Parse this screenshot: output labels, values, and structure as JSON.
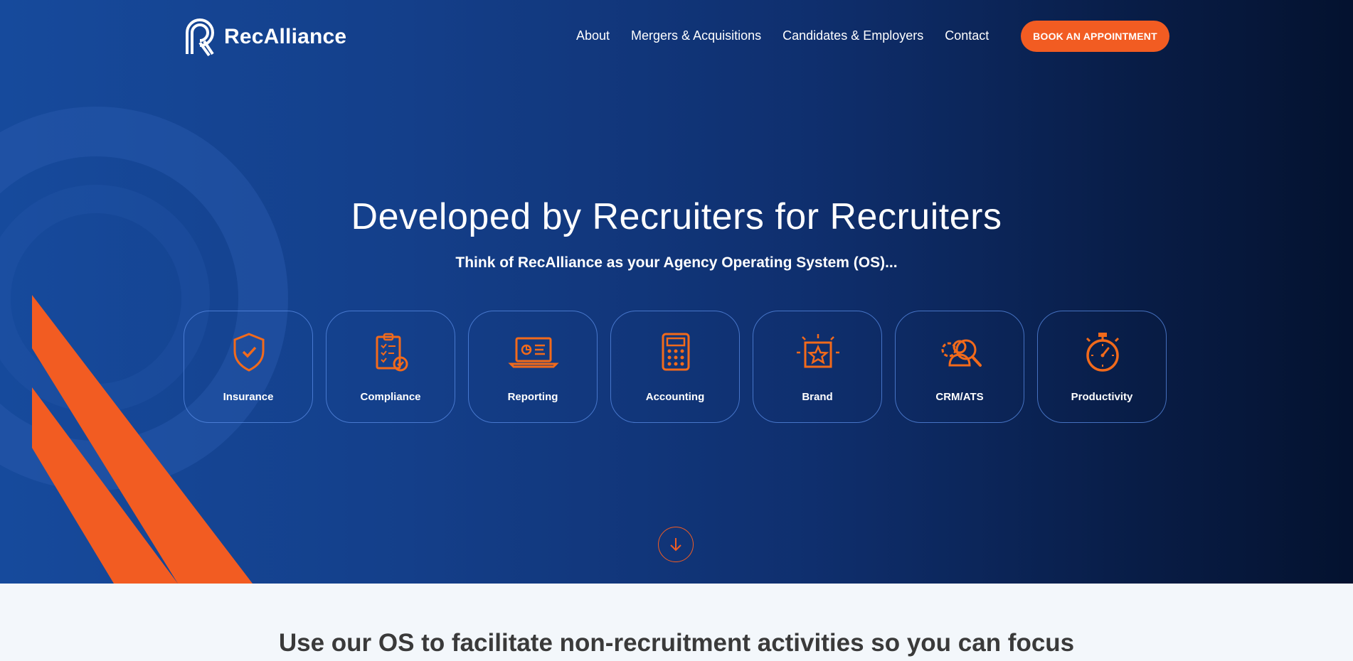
{
  "brand": {
    "name": "RecAlliance",
    "accent_color": "#f25c22",
    "hero_gradient": [
      "#164a9c",
      "#04122f"
    ]
  },
  "nav": {
    "links": [
      "About",
      "Mergers & Acquisitions",
      "Candidates & Employers",
      "Contact"
    ],
    "cta_label": "BOOK AN APPOINTMENT"
  },
  "hero": {
    "headline": "Developed by Recruiters for Recruiters",
    "subheadline": "Think of RecAlliance as your Agency Operating System (OS)...",
    "features": [
      {
        "label": "Insurance",
        "icon": "shield-check-icon"
      },
      {
        "label": "Compliance",
        "icon": "clipboard-check-icon"
      },
      {
        "label": "Reporting",
        "icon": "laptop-chart-icon"
      },
      {
        "label": "Accounting",
        "icon": "calculator-icon"
      },
      {
        "label": "Brand",
        "icon": "star-frame-icon"
      },
      {
        "label": "CRM/ATS",
        "icon": "users-search-icon"
      },
      {
        "label": "Productivity",
        "icon": "stopwatch-icon"
      }
    ],
    "scroll_icon": "arrow-down-icon"
  },
  "section2": {
    "title": "Use our OS to facilitate non-recruitment activities so you can focus"
  }
}
